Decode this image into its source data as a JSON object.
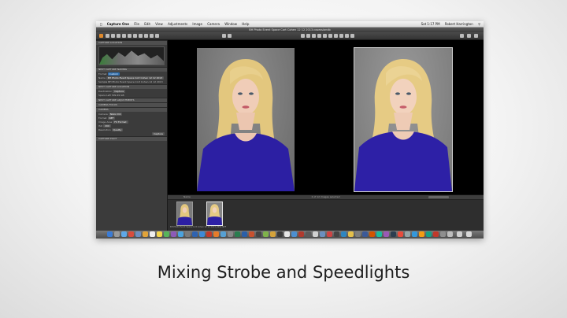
{
  "menubar": {
    "app": "Capture One",
    "items": [
      "File",
      "Edit",
      "View",
      "Adjustments",
      "Image",
      "Camera",
      "Window",
      "Help"
    ],
    "clock": "Sat 1:17 PM",
    "user": "Robert Harrington"
  },
  "window": {
    "title": "BH Photo Event Space Cort Cohen 12 12 2013.cosessiondb"
  },
  "sidebar": {
    "panels": [
      {
        "title": "CAPTURE LOCATION",
        "rows": []
      },
      {
        "title": "NEXT CAPTURE NAMING",
        "rows": [
          {
            "label": "Format",
            "value": "Custom"
          },
          {
            "label": "Name",
            "value": "BH Photo Event Space Cort Cohen 12 12 2013"
          },
          {
            "label": "Sample",
            "value": "BH Photo Event Space Cort Cohen 12 12 2013"
          }
        ]
      },
      {
        "title": "NEXT CAPTURE LOCATION",
        "rows": [
          {
            "label": "Destination",
            "value": "Capture"
          },
          {
            "label": "Space Left",
            "value": "309.49 GB"
          }
        ]
      },
      {
        "title": "NEXT CAPTURE ADJUSTMENTS",
        "rows": []
      },
      {
        "title": "CAMERA FOCUS",
        "rows": []
      },
      {
        "title": "CAMERA",
        "rows": [
          {
            "label": "Camera",
            "value": "Nikon D4"
          },
          {
            "label": "Format",
            "value": "NEF"
          },
          {
            "label": "Image Area",
            "value": "FX Format"
          },
          {
            "label": "ISO",
            "value": "200"
          },
          {
            "label": "Resolution",
            "value": "Quality"
          }
        ]
      },
      {
        "title": "CAPTURE PILOT",
        "rows": []
      }
    ],
    "capture_button": "Capture"
  },
  "viewer": {
    "photos": [
      {
        "name": "BH Photo Event Space Cort Cohen 12 12 2013_0011.NEF"
      },
      {
        "name": "BH Photo Event Space Cort Cohen 12 12 2013_0012.NEF"
      }
    ]
  },
  "filmstrip": {
    "sort_label": "Name",
    "count_label": "2 of 12 images selected"
  },
  "caption": "Mixing Strobe and Speedlights"
}
